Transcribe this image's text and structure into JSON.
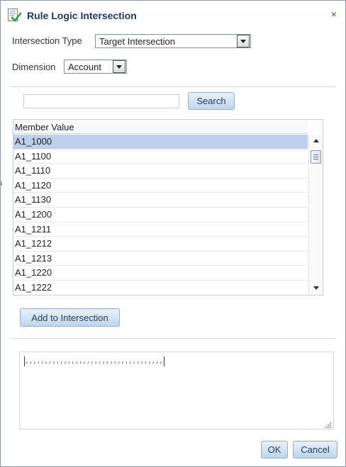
{
  "dialog": {
    "title": "Rule Logic Intersection",
    "close_glyph": "×"
  },
  "form": {
    "intersection_type_label": "Intersection Type",
    "intersection_type_value": "Target Intersection",
    "dimension_label": "Dimension",
    "dimension_value": "Account"
  },
  "search": {
    "value": "",
    "button_label": "Search"
  },
  "members": {
    "column_header": "Member Value",
    "rows": [
      "A1_1000",
      "A1_1100",
      "A1_1110",
      "A1_1120",
      "A1_1130",
      "A1_1200",
      "A1_1211",
      "A1_1212",
      "A1_1213",
      "A1_1220",
      "A1_1222"
    ],
    "selected_index": 0
  },
  "add_button_label": "Add to Intersection",
  "expression": {
    "text": ",,,,,,,,,,,,,,,,,,,,,,,,,,,,,,,,,,,,"
  },
  "footer": {
    "ok_label": "OK",
    "cancel_label": "Cancel"
  },
  "colors": {
    "title": "#1c3a61",
    "selected_row": "#bcd0ea",
    "button_top": "#e8f1fa",
    "button_bottom": "#bfd5ea"
  },
  "icons": {
    "title": "rule-checklist-icon",
    "close": "close-icon",
    "dropdown": "chevron-down-icon",
    "resize": "resize-grip-icon"
  }
}
